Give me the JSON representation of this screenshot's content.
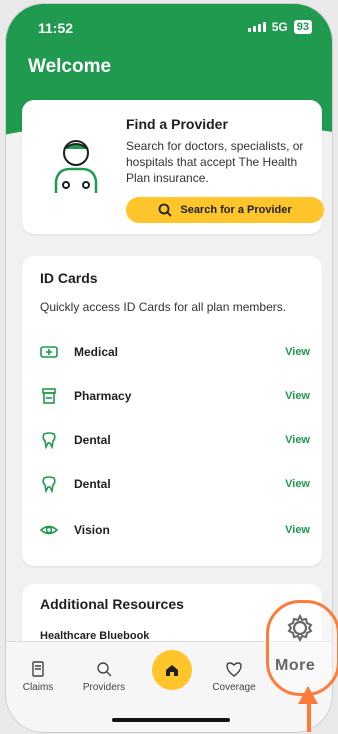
{
  "status": {
    "time": "11:52",
    "network": "5G",
    "battery": "93"
  },
  "header": {
    "title": "Welcome"
  },
  "provider": {
    "title": "Find a Provider",
    "description": "Search for doctors, specialists, or hospitals that accept The Health Plan insurance.",
    "button_label": "Search for a Provider"
  },
  "id_cards": {
    "title": "ID Cards",
    "description": "Quickly access ID Cards for all plan members.",
    "rows": [
      {
        "label": "Medical",
        "action": "View",
        "icon": "ambulance-icon"
      },
      {
        "label": "Pharmacy",
        "action": "View",
        "icon": "pharmacy-icon"
      },
      {
        "label": "Dental",
        "action": "View",
        "icon": "tooth-icon"
      },
      {
        "label": "Dental",
        "action": "View",
        "icon": "tooth-icon"
      },
      {
        "label": "Vision",
        "action": "View",
        "icon": "eye-icon"
      }
    ]
  },
  "resources": {
    "title": "Additional Resources",
    "items": [
      "Healthcare Bluebook"
    ]
  },
  "nav": {
    "items": [
      {
        "label": "Claims",
        "icon": "claims-icon"
      },
      {
        "label": "Providers",
        "icon": "search-icon"
      },
      {
        "label": "",
        "icon": "home-icon"
      },
      {
        "label": "Coverage",
        "icon": "heart-shield-icon"
      },
      {
        "label": "More",
        "icon": "gear-icon"
      }
    ]
  },
  "colors": {
    "brand_green": "#1f9a4e",
    "accent_yellow": "#ffc52b",
    "annotation_orange": "#ff7b3a"
  }
}
